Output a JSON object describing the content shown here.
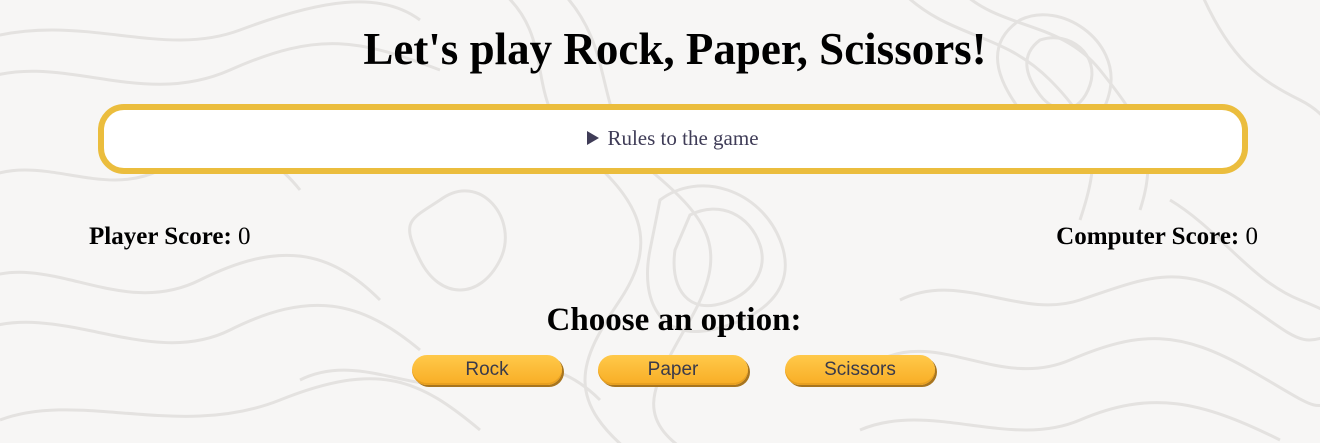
{
  "page": {
    "title": "Let's play Rock, Paper, Scissors!"
  },
  "rules": {
    "summary": "Rules to the game",
    "icon": "disclosure-triangle-icon"
  },
  "scores": {
    "player_label": "Player Score:",
    "player_value": "0",
    "computer_label": "Computer Score:",
    "computer_value": "0"
  },
  "choice": {
    "heading": "Choose an option:",
    "options": [
      "Rock",
      "Paper",
      "Scissors"
    ]
  },
  "colors": {
    "background": "#f7f6f5",
    "rules_border": "#ebbd3d",
    "button_fill": "#ffc94a",
    "button_shadow": "#a8751e",
    "rules_text": "#3f3c57"
  }
}
